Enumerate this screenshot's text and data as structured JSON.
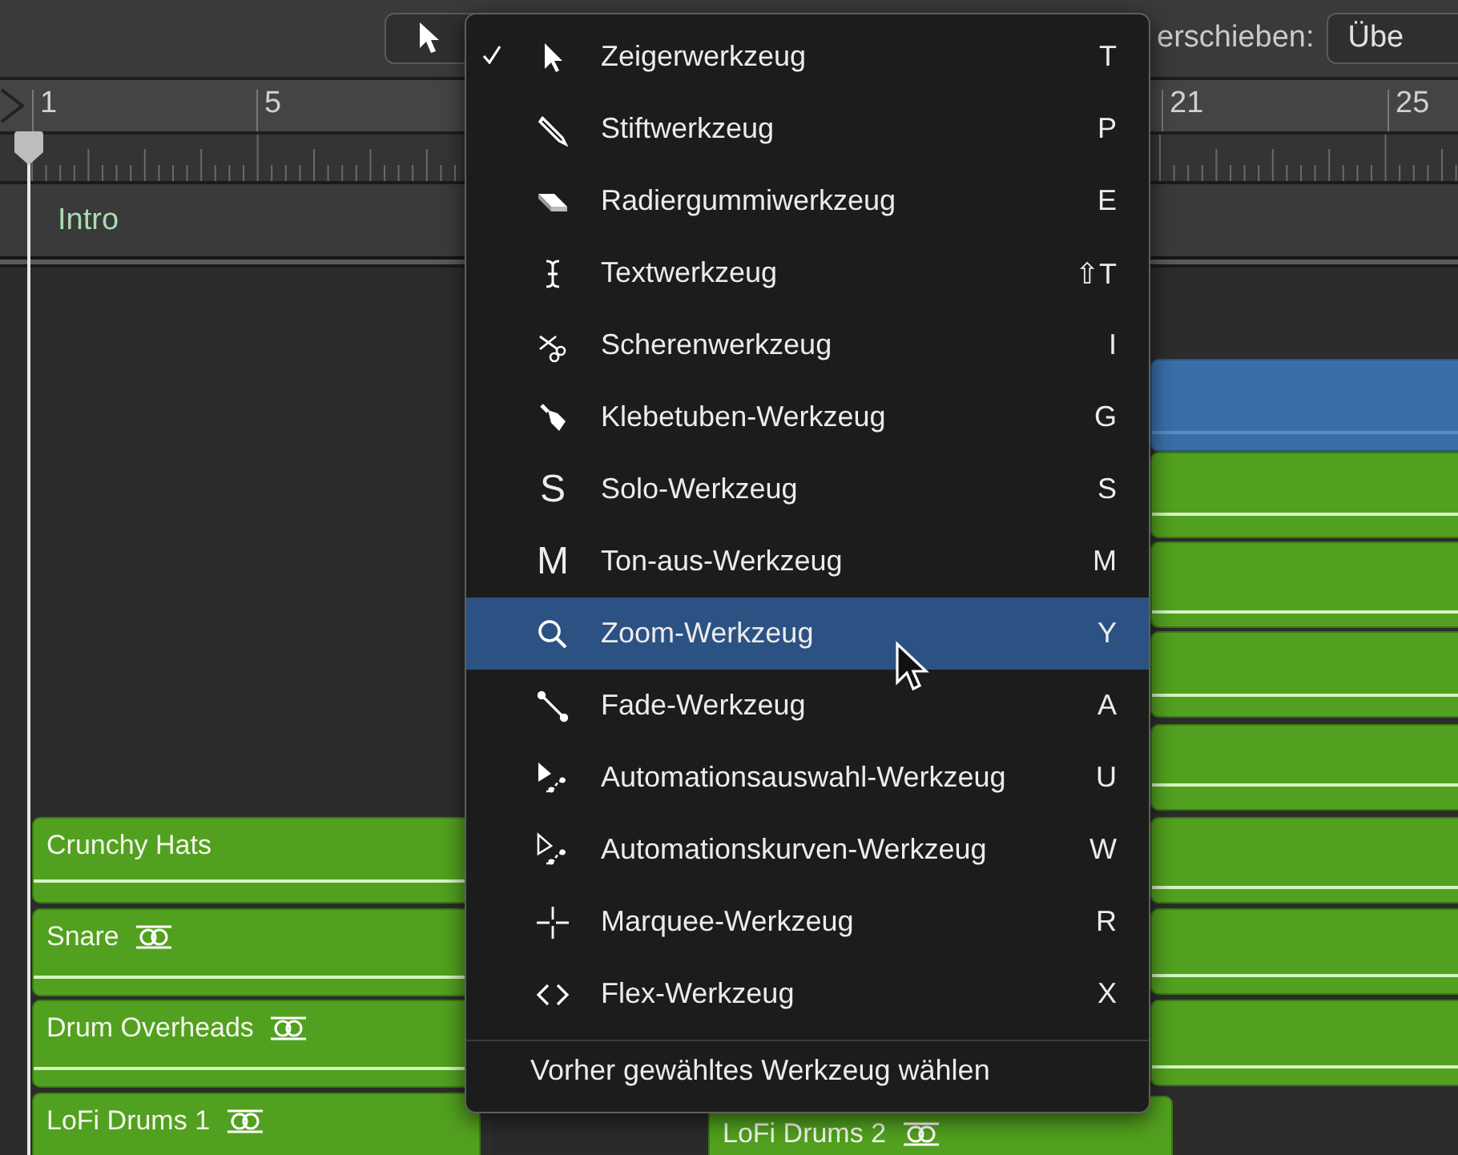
{
  "toolbar": {
    "drag_label": "erschieben:",
    "drag_button": "Übe"
  },
  "ruler": {
    "bars": [
      {
        "label": "1"
      },
      {
        "label": "5"
      },
      {
        "label": "21"
      },
      {
        "label": "25"
      }
    ]
  },
  "marker": {
    "label": "Intro"
  },
  "regions": [
    {
      "name": "Crunchy Hats",
      "linked": false
    },
    {
      "name": "Snare",
      "linked": true
    },
    {
      "name": "Drum Overheads",
      "linked": true
    },
    {
      "name": "LoFi Drums 1",
      "linked": true
    },
    {
      "name": "LoFi Drums 2",
      "linked": true
    }
  ],
  "tool_menu": {
    "items": [
      {
        "label": "Zeigerwerkzeug",
        "shortcut": "T",
        "checked": true,
        "selected": false
      },
      {
        "label": "Stiftwerkzeug",
        "shortcut": "P",
        "checked": false,
        "selected": false
      },
      {
        "label": "Radiergummiwerkzeug",
        "shortcut": "E",
        "checked": false,
        "selected": false
      },
      {
        "label": "Textwerkzeug",
        "shortcut": "⇧T",
        "checked": false,
        "selected": false
      },
      {
        "label": "Scherenwerkzeug",
        "shortcut": "I",
        "checked": false,
        "selected": false
      },
      {
        "label": "Klebetuben-Werkzeug",
        "shortcut": "G",
        "checked": false,
        "selected": false
      },
      {
        "label": "Solo-Werkzeug",
        "shortcut": "S",
        "icon_text": "S",
        "checked": false,
        "selected": false
      },
      {
        "label": "Ton-aus-Werkzeug",
        "shortcut": "M",
        "icon_text": "M",
        "checked": false,
        "selected": false
      },
      {
        "label": "Zoom-Werkzeug",
        "shortcut": "Y",
        "checked": false,
        "selected": true
      },
      {
        "label": "Fade-Werkzeug",
        "shortcut": "A",
        "checked": false,
        "selected": false
      },
      {
        "label": "Automationsauswahl-Werkzeug",
        "shortcut": "U",
        "checked": false,
        "selected": false
      },
      {
        "label": "Automationskurven-Werkzeug",
        "shortcut": "W",
        "checked": false,
        "selected": false
      },
      {
        "label": "Marquee-Werkzeug",
        "shortcut": "R",
        "checked": false,
        "selected": false
      },
      {
        "label": "Flex-Werkzeug",
        "shortcut": "X",
        "checked": false,
        "selected": false
      }
    ],
    "footer": "Vorher gewähltes Werkzeug wählen"
  }
}
